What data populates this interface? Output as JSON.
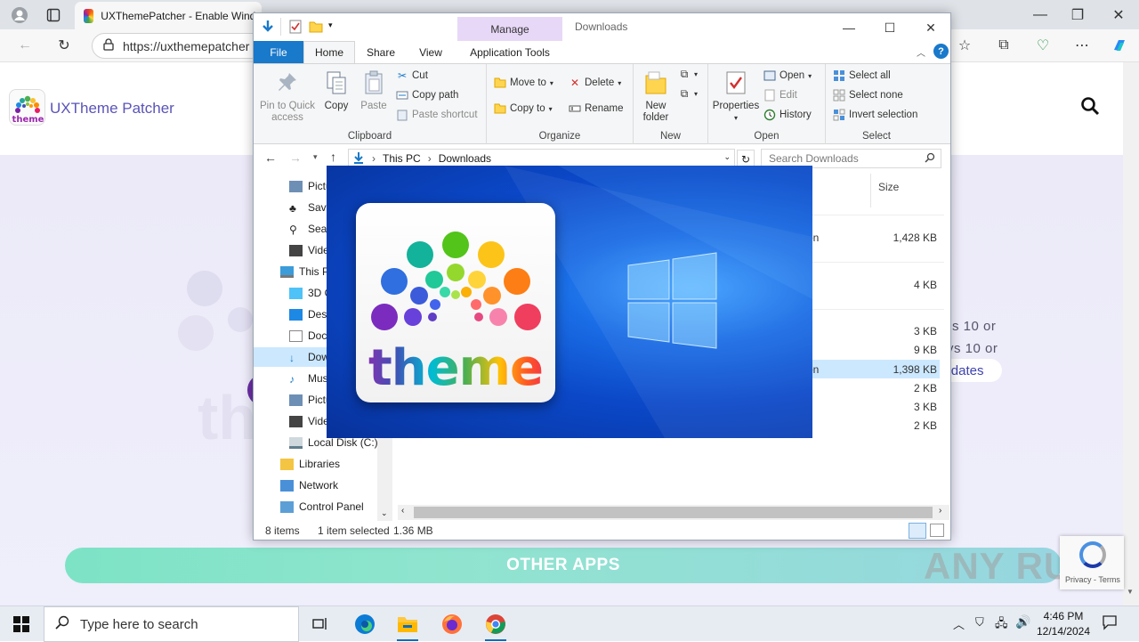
{
  "browser": {
    "tab_title": "UXThemePatcher - Enable Windo",
    "url": "https://uxthemepatcher"
  },
  "site": {
    "name": "UXTheme Patcher",
    "hero_line1": "s 10 or",
    "hero_line2": "vs 10 or",
    "hero_pill": "pdates",
    "other_apps": "OTHER APPS"
  },
  "explorer": {
    "title": "Downloads",
    "manage_label": "Manage",
    "tabs": {
      "file": "File",
      "home": "Home",
      "share": "Share",
      "view": "View",
      "app_tools": "Application Tools"
    },
    "clipboard": {
      "pin": "Pin to Quick access",
      "copy": "Copy",
      "paste": "Paste",
      "cut": "Cut",
      "copy_path": "Copy path",
      "paste_shortcut": "Paste shortcut",
      "label": "Clipboard"
    },
    "organize": {
      "move_to": "Move to",
      "copy_to": "Copy to",
      "delete": "Delete",
      "rename": "Rename",
      "label": "Organize"
    },
    "new": {
      "new_folder": "New folder",
      "label": "New"
    },
    "open": {
      "properties": "Properties",
      "open": "Open",
      "edit": "Edit",
      "history": "History",
      "label": "Open"
    },
    "select": {
      "select_all": "Select all",
      "select_none": "Select none",
      "invert": "Invert selection",
      "label": "Select"
    },
    "path": {
      "this_pc": "This PC",
      "downloads": "Downloads"
    },
    "search_placeholder": "Search Downloads",
    "nav": [
      "Pictu",
      "Save",
      "Sear",
      "Vide",
      "This P",
      "3D O",
      "Desk",
      "Docu",
      "Dow",
      "Musi",
      "Pictu",
      "Vide",
      "Local Disk (C:)",
      "Libraries",
      "Network",
      "Control Panel"
    ],
    "size_header": "Size",
    "rows": [
      {
        "type": "on",
        "size": "1,428 KB"
      },
      {
        "type": "",
        "size": "4 KB"
      },
      {
        "type": "",
        "size": "3 KB"
      },
      {
        "type": "",
        "size": "9 KB"
      },
      {
        "type": "on",
        "size": "1,398 KB"
      },
      {
        "type": "",
        "size": "2 KB"
      },
      {
        "type": "",
        "size": "3 KB"
      },
      {
        "type": "",
        "size": "2 KB"
      }
    ],
    "status": {
      "items": "8 items",
      "selected": "1 item selected",
      "size": "1.36 MB"
    }
  },
  "splash": {
    "word": "theme"
  },
  "watermark": "ANY RUN",
  "recaptcha": "Privacy - Terms",
  "taskbar": {
    "search_placeholder": "Type here to search",
    "time": "4:46 PM",
    "date": "12/14/2024"
  },
  "colors": {
    "accent": "#1979ca",
    "manage": "#e8d8f7",
    "other_apps": "#7de3c5",
    "selection": "#cce8ff"
  }
}
